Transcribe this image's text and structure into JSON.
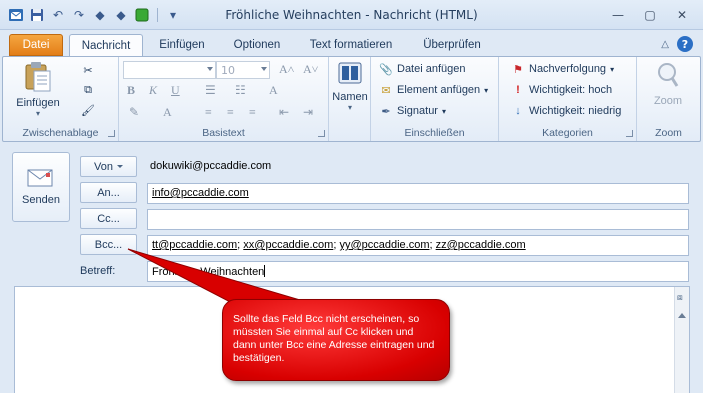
{
  "window": {
    "title": "Fröhliche Weihnachten  -  Nachricht (HTML)",
    "controls": [
      "minimize",
      "maximize",
      "close"
    ]
  },
  "quick_access": [
    "outlook-icon",
    "save-icon",
    "undo-icon",
    "redo-icon",
    "up-icon",
    "down-icon",
    "green-icon",
    "customize-icon"
  ],
  "tabs": [
    {
      "label": "Datei"
    },
    {
      "label": "Nachricht"
    },
    {
      "label": "Einfügen"
    },
    {
      "label": "Optionen"
    },
    {
      "label": "Text formatieren"
    },
    {
      "label": "Überprüfen"
    }
  ],
  "ribbon": {
    "clipboard": {
      "paste_label": "Einfügen",
      "group_label": "Zwischenablage"
    },
    "basic_text": {
      "font_size": "10",
      "group_label": "Basistext"
    },
    "names": {
      "label": "Namen"
    },
    "include": {
      "attach_file": "Datei anfügen",
      "attach_item": "Element anfügen",
      "signature": "Signatur",
      "group_label": "Einschließen"
    },
    "categories": {
      "follow_up": "Nachverfolgung",
      "high_importance": "Wichtigkeit: hoch",
      "low_importance": "Wichtigkeit: niedrig",
      "group_label": "Kategorien"
    },
    "zoom": {
      "label": "Zoom",
      "group_label": "Zoom"
    }
  },
  "compose": {
    "send_label": "Senden",
    "from_button": "Von",
    "from_value": "dokuwiki@pccaddie.com",
    "to_button": "An...",
    "to_value": "info@pccaddie.com",
    "cc_button": "Cc...",
    "cc_value": "",
    "bcc_button": "Bcc...",
    "bcc_recipients": [
      "tt@pccaddie.com",
      "xx@pccaddie.com",
      "yy@pccaddie.com",
      "zz@pccaddie.com"
    ],
    "subject_label": "Betreff:",
    "subject_value": "Fröhliche Weihnachten"
  },
  "callout": {
    "text": "Sollte das Feld Bcc nicht erscheinen, so müssten Sie einmal auf Cc klicken und dann unter Bcc eine Adresse eintragen und bestätigen.",
    "color": "#e00000"
  }
}
